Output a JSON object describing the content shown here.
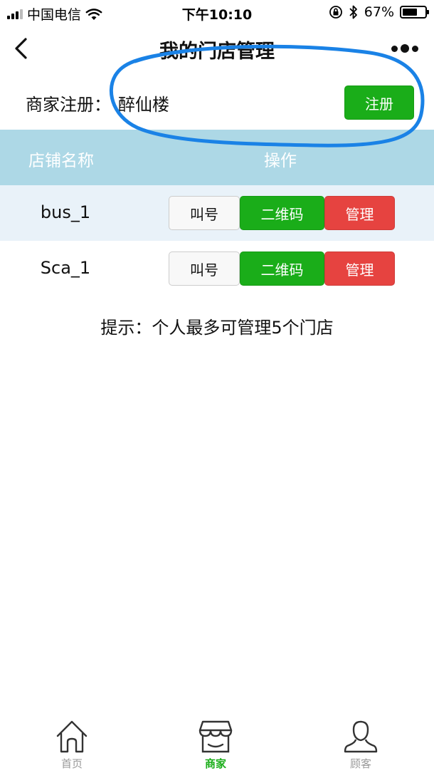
{
  "status_bar": {
    "carrier": "中国电信",
    "time": "下午10:10",
    "battery": "67%",
    "battery_level": 0.67
  },
  "nav": {
    "title": "我的门店管理"
  },
  "register": {
    "label": "商家注册：",
    "value": "醉仙楼",
    "button_label": "注册"
  },
  "table": {
    "headers": [
      "店铺名称",
      "操作"
    ],
    "rows": [
      {
        "name": "bus_1",
        "actions": [
          "叫号",
          "二维码",
          "管理"
        ]
      },
      {
        "name": "Sca_1",
        "actions": [
          "叫号",
          "二维码",
          "管理"
        ]
      }
    ]
  },
  "tip": "提示：个人最多可管理5个门店",
  "tab_bar": {
    "items": [
      {
        "label": "首页",
        "icon": "home-icon",
        "active": false
      },
      {
        "label": "商家",
        "icon": "store-icon",
        "active": true
      },
      {
        "label": "顾客",
        "icon": "user-icon",
        "active": false
      }
    ]
  },
  "colors": {
    "primary_green": "#1aad19",
    "danger_red": "#e64340",
    "header_blue": "#add8e6",
    "row_highlight": "#e9f2f9",
    "annotation_blue": "#1a82e6"
  }
}
